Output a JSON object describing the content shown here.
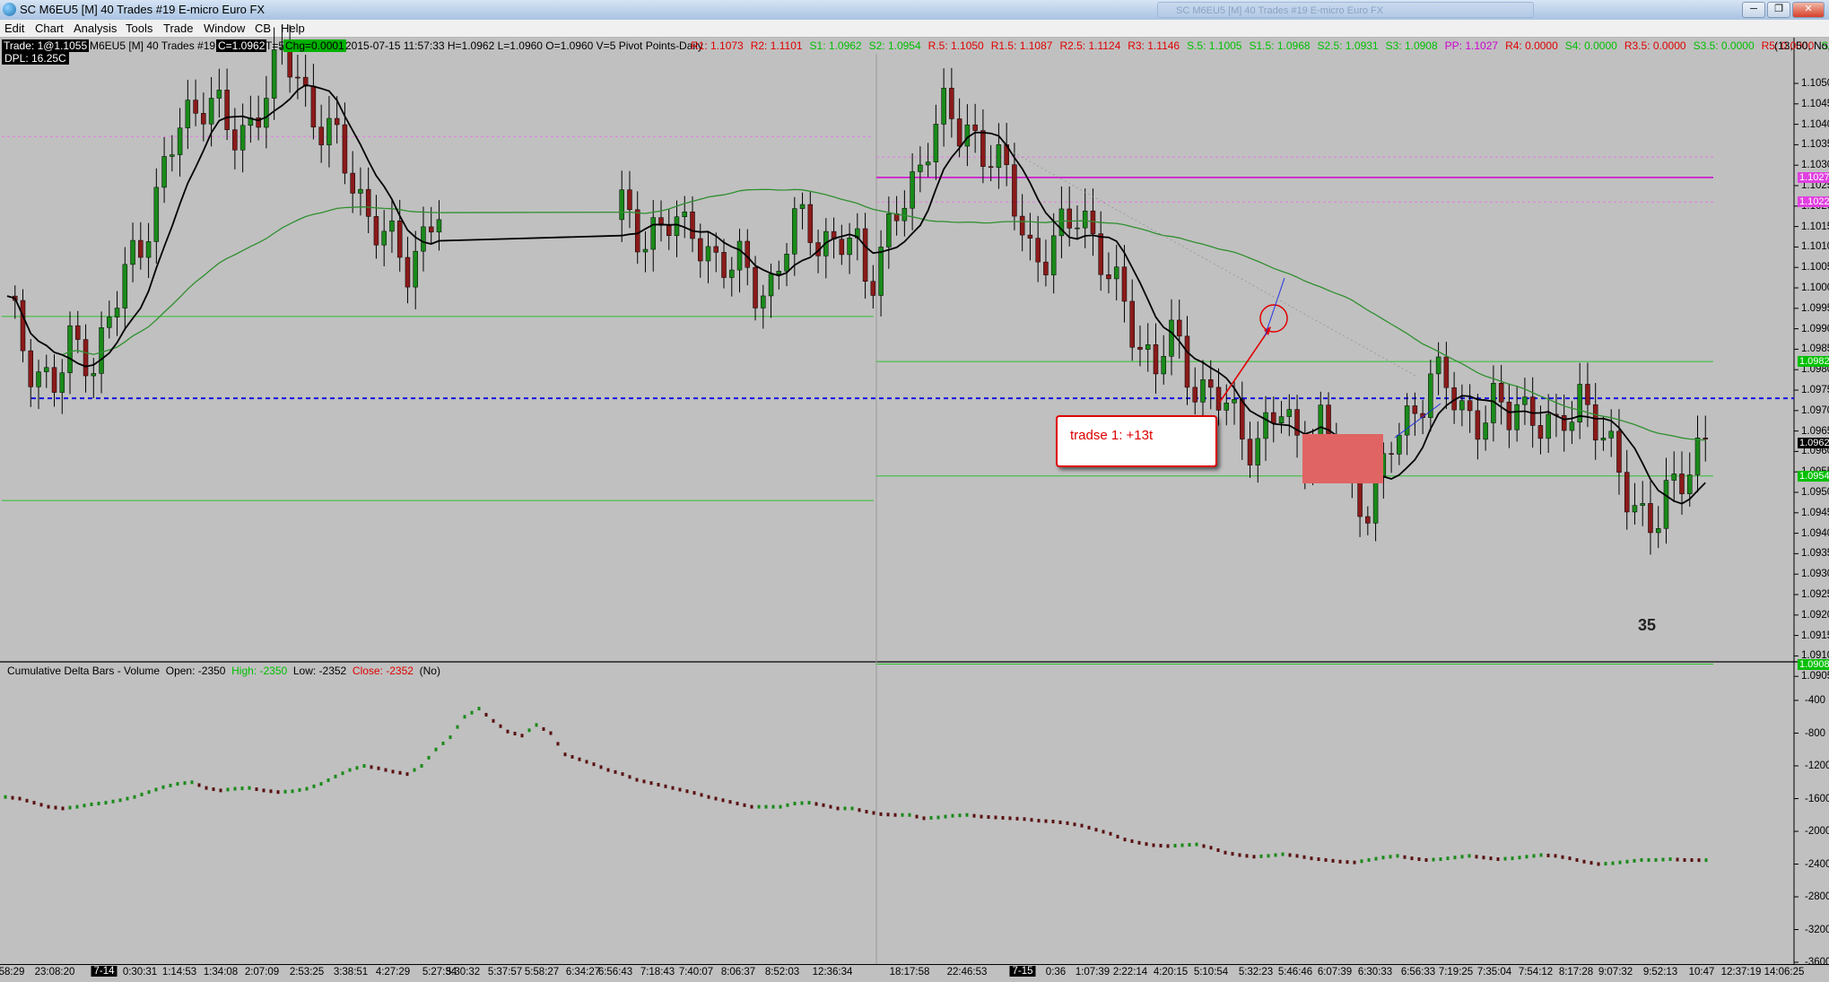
{
  "window": {
    "title": "SC M6EU5 [M]  40 Trades  #19  E-micro Euro FX",
    "background_tab": "SC M6EU5 [M]  40 Trades  #19  E-micro Euro FX",
    "buttons": {
      "minimize": "─",
      "restore": "❐",
      "close": "✕"
    }
  },
  "menu": [
    "Edit",
    "Chart",
    "Analysis",
    "Tools",
    "Trade",
    "Window",
    "CB",
    "Help"
  ],
  "infobar": {
    "trade": "Trade: 1@1.1055",
    "symbol": "M6EU5 [M]  40 Trades  #19",
    "close": "C=1.0962",
    "t": "T=5",
    "chg": "Chg=0.0001",
    "ohlc": "2015-07-15 11:57:33 H=1.0962 L=1.0960 O=1.0960 V=5 Pivot Points-Daily",
    "pivots": [
      {
        "text": "R1: 1.1073",
        "color": "#e00000"
      },
      {
        "text": "R2: 1.1101",
        "color": "#e00000"
      },
      {
        "text": "S1: 1.0962",
        "color": "#00c000"
      },
      {
        "text": "S2: 1.0954",
        "color": "#00c000"
      },
      {
        "text": "R.5: 1.1050",
        "color": "#e00000"
      },
      {
        "text": "R1.5: 1.1087",
        "color": "#e00000"
      },
      {
        "text": "R2.5: 1.1124",
        "color": "#e00000"
      },
      {
        "text": "R3: 1.1146",
        "color": "#e00000"
      },
      {
        "text": "S.5: 1.1005",
        "color": "#00c000"
      },
      {
        "text": "S1.5: 1.0968",
        "color": "#00c000"
      },
      {
        "text": "S2.5: 1.0931",
        "color": "#00c000"
      },
      {
        "text": "S3: 1.0908",
        "color": "#00c000"
      },
      {
        "text": "PP: 1.1027",
        "color": "#d000d0"
      },
      {
        "text": "R4: 0.0000",
        "color": "#e00000"
      },
      {
        "text": "S4: 0.0000",
        "color": "#00c000"
      },
      {
        "text": "R3.5: 0.0000",
        "color": "#e00000"
      },
      {
        "text": "S3.5: 0.0000",
        "color": "#00c000"
      },
      {
        "text": "R5: 0.0000",
        "color": "#e00000"
      },
      {
        "text": "S5: 0.0000",
        "color": "#00c000"
      }
    ],
    "tail": "(13, 50, No, N"
  },
  "dpl": "DPL: 16.25C",
  "price_axis": {
    "labels": [
      "1.1050",
      "1.1045",
      "1.1040",
      "1.1035",
      "1.1030",
      "1.1025",
      "1.1020",
      "1.1015",
      "1.1010",
      "1.1005",
      "1.1000",
      "1.0995",
      "1.0990",
      "1.0985",
      "1.0980",
      "1.0975",
      "1.0970",
      "1.0965",
      "1.0960",
      "1.0955",
      "1.0950",
      "1.0945",
      "1.0940",
      "1.0935",
      "1.0930",
      "1.0925",
      "1.0920",
      "1.0915",
      "1.0910",
      "1.0905"
    ],
    "tags": [
      {
        "text": "1.1027",
        "value": 1.1027,
        "bg": "#e040e0",
        "fg": "#ffffff"
      },
      {
        "text": "1.1022",
        "value": 1.1021,
        "bg": "#e040e0",
        "fg": "#ffffff"
      },
      {
        "text": "1.0982",
        "value": 1.0982,
        "bg": "#00c000",
        "fg": "#ffffff"
      },
      {
        "text": "1.0962",
        "value": 1.0962,
        "bg": "#000000",
        "fg": "#ffffff"
      },
      {
        "text": "1.0954",
        "value": 1.0954,
        "bg": "#00c000",
        "fg": "#ffffff"
      },
      {
        "text": "1.0908",
        "value": 1.0908,
        "bg": "#00c000",
        "fg": "#ffffff"
      }
    ]
  },
  "subchart": {
    "title": "Cumulative Delta Bars - Volume",
    "open": "Open: -2350",
    "high": "High: -2350",
    "low": "Low: -2352",
    "close": "Close: -2352",
    "flag": "(No)",
    "axis_labels": [
      "-400",
      "-800",
      "-1200",
      "-1600",
      "-2000",
      "-2400",
      "-2800",
      "-3200",
      "-3600"
    ]
  },
  "time_axis": {
    "labels": [
      "58:29",
      "23:08:20",
      "0:30:31",
      "1:14:53",
      "1:34:08",
      "2:07:09",
      "2:53:25",
      "3:38:51",
      "4:27:29",
      "5:27:34",
      "5:30:32",
      "5:37:57",
      "5:58:27",
      "6:34:27",
      "6:56:43",
      "7:18:43",
      "7:40:07",
      "8:06:37",
      "8:52:03",
      "12:36:34",
      "18:17:58",
      "22:46:53",
      "0:36",
      "1:07:39",
      "2:22:14",
      "4:20:15",
      "5:10:54",
      "5:32:23",
      "5:46:46",
      "6:07:39",
      "6:30:33",
      "6:56:33",
      "7:19:25",
      "7:35:04",
      "7:54:12",
      "8:17:28",
      "9:07:32",
      "9:52:13",
      "10:47",
      "12:37:19",
      "14:06:25"
    ],
    "day_marks": [
      "7-14",
      "7-15"
    ]
  },
  "annotations": {
    "callout": "tradse 1: +13t",
    "bar_count": "35"
  },
  "chart_data": [
    {
      "type": "candlestick",
      "title": "SC M6EU5 [M] 40 Trades #19 E-micro Euro FX",
      "ylim": [
        1.0903,
        1.1056
      ],
      "close_path": [
        1.0995,
        1.0988,
        1.0982,
        1.0978,
        1.0975,
        1.0985,
        1.0987,
        1.0982,
        1.099,
        1.0998,
        1.1008,
        1.1015,
        1.1022,
        1.1032,
        1.104,
        1.1045,
        1.1048,
        1.1042,
        1.1035,
        1.1038,
        1.1045,
        1.105,
        1.1055,
        1.1054,
        1.1047,
        1.104,
        1.1036,
        1.103,
        1.1025,
        1.1018,
        1.1013,
        1.1008,
        1.1005,
        1.1012,
        1.1017,
        1.1018,
        1.1015,
        1.1013,
        1.1016,
        1.1015,
        1.1012,
        1.1016,
        1.101,
        1.1005,
        1.1003,
        1.1007,
        1.1002,
        1.0998,
        1.1005,
        1.1015,
        1.102,
        1.1012,
        1.1008,
        1.101,
        1.1012,
        1.1003,
        1.1008,
        1.1015,
        1.1022,
        1.103,
        1.104,
        1.1042,
        1.1037,
        1.104,
        1.1035,
        1.1032,
        1.1025,
        1.1018,
        1.101,
        1.1007,
        1.101,
        1.1015,
        1.1022,
        1.1012,
        1.1003,
        1.0997,
        1.0992,
        1.0986,
        1.098,
        1.0988,
        1.0983,
        1.0978,
        1.0975,
        1.0972,
        1.0968,
        1.0965,
        1.0963,
        1.0966,
        1.0969,
        1.0964,
        1.0962,
        1.0968,
        1.096,
        1.0955,
        1.095,
        1.0948,
        1.0952,
        1.0962,
        1.0968,
        1.0973,
        1.0978,
        1.0975,
        1.0973,
        1.097,
        1.0968,
        1.097,
        1.0967,
        1.0974,
        1.097,
        1.0966,
        1.0962,
        1.097,
        1.0976,
        1.0968,
        1.096,
        1.0955,
        1.095,
        1.0945,
        1.094,
        1.0948,
        1.0955,
        1.096,
        1.0962
      ],
      "moving_averages": [
        "black short MA",
        "green long MA"
      ],
      "pivot_lines_day1": [
        1.0993,
        1.0948
      ],
      "pivot_lines_day2": [
        1.1027,
        1.1021,
        1.1032,
        1.0982,
        1.0954,
        1.0908
      ],
      "dashed_line_blue": 1.0973,
      "day1_pp_dashed": 1.1037
    },
    {
      "type": "line",
      "title": "Cumulative Delta Bars - Volume",
      "ylim": [
        -3600,
        -200
      ],
      "values": [
        -1580,
        -1600,
        -1650,
        -1700,
        -1720,
        -1700,
        -1670,
        -1650,
        -1620,
        -1580,
        -1520,
        -1460,
        -1420,
        -1400,
        -1470,
        -1500,
        -1480,
        -1470,
        -1500,
        -1520,
        -1510,
        -1480,
        -1420,
        -1330,
        -1250,
        -1200,
        -1230,
        -1270,
        -1300,
        -1200,
        -1000,
        -850,
        -600,
        -500,
        -650,
        -780,
        -830,
        -700,
        -800,
        -1060,
        -1120,
        -1180,
        -1250,
        -1300,
        -1370,
        -1410,
        -1450,
        -1490,
        -1530,
        -1580,
        -1620,
        -1660,
        -1700,
        -1700,
        -1700,
        -1660,
        -1650,
        -1680,
        -1720,
        -1720,
        -1760,
        -1790,
        -1800,
        -1800,
        -1840,
        -1830,
        -1810,
        -1800,
        -1820,
        -1830,
        -1840,
        -1850,
        -1870,
        -1880,
        -1900,
        -1930,
        -1980,
        -2030,
        -2100,
        -2140,
        -2170,
        -2180,
        -2170,
        -2160,
        -2200,
        -2260,
        -2290,
        -2310,
        -2300,
        -2280,
        -2300,
        -2330,
        -2350,
        -2370,
        -2380,
        -2350,
        -2320,
        -2300,
        -2330,
        -2350,
        -2340,
        -2320,
        -2300,
        -2320,
        -2340,
        -2330,
        -2310,
        -2290,
        -2300,
        -2330,
        -2370,
        -2400,
        -2390,
        -2370,
        -2350,
        -2350,
        -2340,
        -2350,
        -2352
      ]
    }
  ]
}
